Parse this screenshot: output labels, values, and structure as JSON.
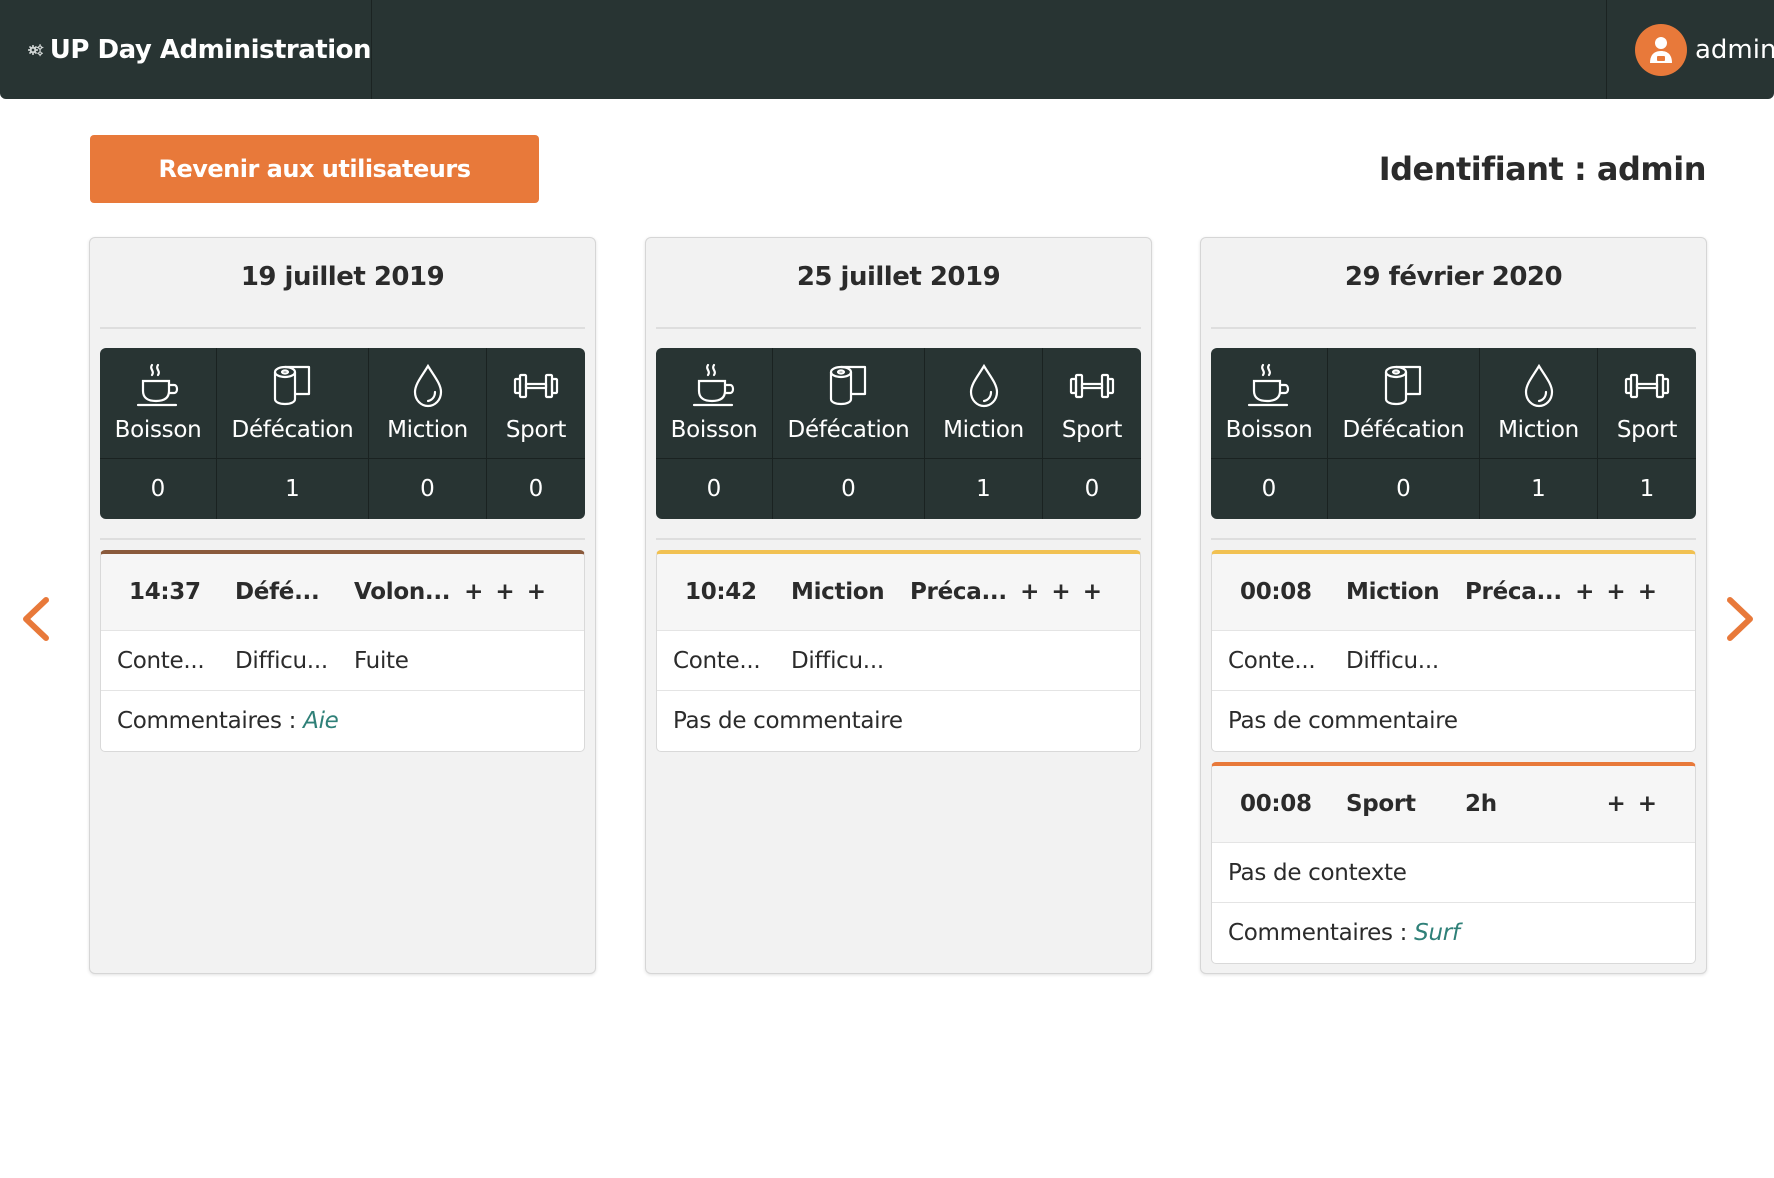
{
  "app": {
    "title": "UP Day Administration",
    "user": "admin"
  },
  "toolbar": {
    "back_label": "Revenir aux utilisateurs",
    "identifier_text": "Identifiant : admin"
  },
  "summary_labels": {
    "boisson": "Boisson",
    "defecation": "Défécation",
    "miction": "Miction",
    "sport": "Sport"
  },
  "colors": {
    "topbar": "#283433",
    "accent": "#e8793a",
    "defecation_event": "#8a5a3c",
    "miction_event": "#f1c152",
    "sport_event": "#e8793a",
    "comment_text": "#2f8078"
  },
  "days": [
    {
      "date": "19 juillet 2019",
      "counts": {
        "boisson": "0",
        "defecation": "1",
        "miction": "0",
        "sport": "0"
      },
      "events": [
        {
          "type": "defecation",
          "time": "14:37",
          "label": "Défé...",
          "extra": "Volon...",
          "more": "+ + +",
          "row1": [
            "Conte...",
            "Difficu...",
            "Fuite"
          ],
          "comment_label": "Commentaires : ",
          "comment_value": "Aie"
        }
      ]
    },
    {
      "date": "25 juillet 2019",
      "counts": {
        "boisson": "0",
        "defecation": "0",
        "miction": "1",
        "sport": "0"
      },
      "events": [
        {
          "type": "miction",
          "time": "10:42",
          "label": "Miction",
          "extra": "Préca...",
          "more": "+ + +",
          "row1": [
            "Conte...",
            "Difficu..."
          ],
          "no_comment": "Pas de commentaire"
        }
      ]
    },
    {
      "date": "29 février 2020",
      "counts": {
        "boisson": "0",
        "defecation": "0",
        "miction": "1",
        "sport": "1"
      },
      "events": [
        {
          "type": "miction",
          "time": "00:08",
          "label": "Miction",
          "extra": "Préca...",
          "more": "+ + +",
          "row1": [
            "Conte...",
            "Difficu..."
          ],
          "no_comment": "Pas de commentaire"
        },
        {
          "type": "sport",
          "time": "00:08",
          "label": "Sport",
          "extra": "2h",
          "more": "+ +",
          "no_context": "Pas de contexte",
          "comment_label": "Commentaires : ",
          "comment_value": "Surf"
        }
      ]
    }
  ]
}
